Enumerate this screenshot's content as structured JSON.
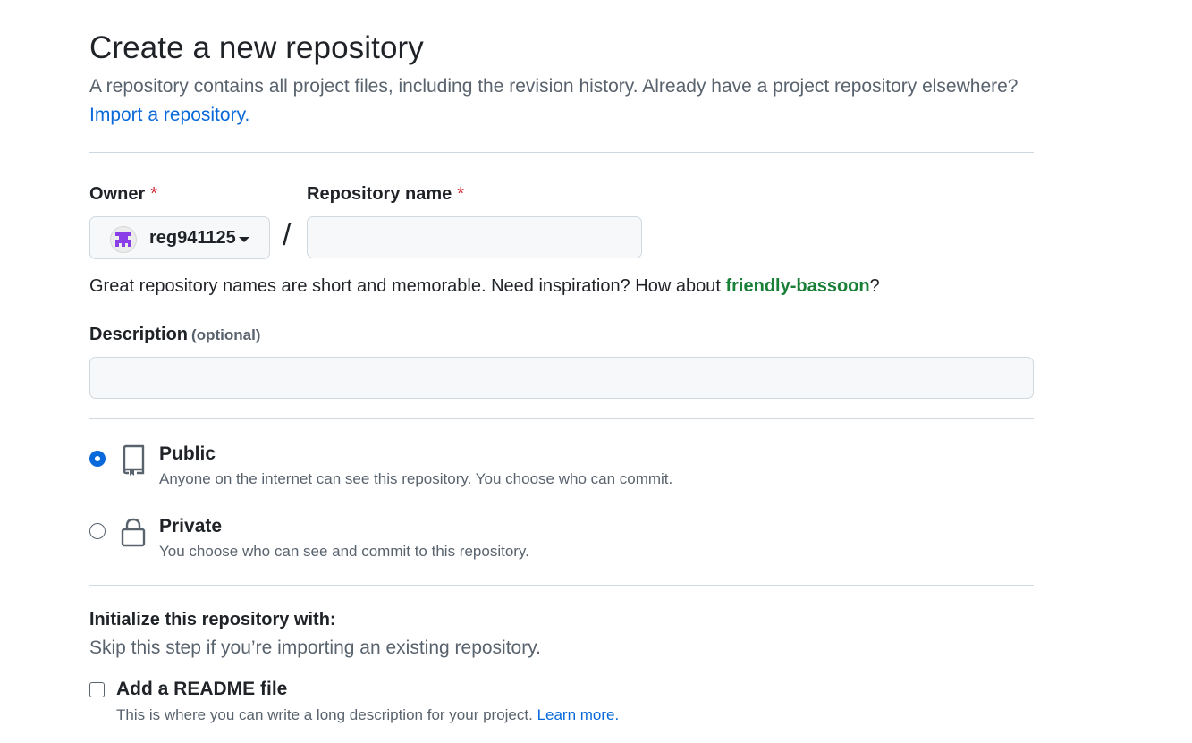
{
  "header": {
    "title": "Create a new repository",
    "subtitle": "A repository contains all project files, including the revision history. Already have a project repository elsewhere?",
    "import_link": "Import a repository."
  },
  "owner": {
    "label": "Owner",
    "required_mark": "*",
    "selected": "reg941125"
  },
  "separator": "/",
  "repo_name": {
    "label": "Repository name",
    "required_mark": "*",
    "value": "",
    "placeholder": ""
  },
  "name_hint": {
    "prefix": "Great repository names are short and memorable. Need inspiration? How about ",
    "suggestion": "friendly-bassoon",
    "suffix": "?"
  },
  "description": {
    "label": "Description",
    "optional_label": "(optional)",
    "value": "",
    "placeholder": ""
  },
  "visibility": {
    "selected": "public",
    "options": [
      {
        "key": "public",
        "title": "Public",
        "description": "Anyone on the internet can see this repository. You choose who can commit.",
        "icon": "repo-icon"
      },
      {
        "key": "private",
        "title": "Private",
        "description": "You choose who can see and commit to this repository.",
        "icon": "lock-icon"
      }
    ]
  },
  "initialize": {
    "title": "Initialize this repository with:",
    "subtitle": "Skip this step if you’re importing an existing repository.",
    "readme": {
      "label": "Add a README file",
      "checked": false,
      "description": "This is where you can write a long description for your project.",
      "learn_more": "Learn more."
    }
  },
  "colors": {
    "accent": "#0969da",
    "suggestion": "#1a7f37",
    "required": "#d1242f",
    "avatar": "#8a3ee8"
  }
}
